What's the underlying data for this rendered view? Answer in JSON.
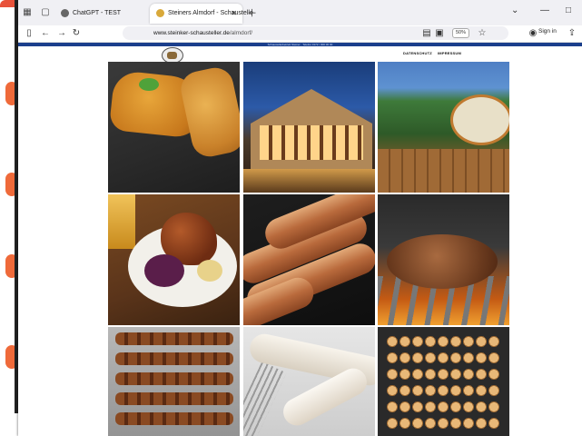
{
  "browser": {
    "tabs": [
      {
        "label": "ChatGPT - TEST",
        "active": false
      },
      {
        "label": "Steiners Almdorf - Schaustelle",
        "active": true
      }
    ],
    "url_scheme_host": "www.steinker-schausteller.de",
    "url_path": "/almdorf/",
    "zoom": "50%",
    "sign_in_label": "Sign in"
  },
  "page": {
    "top_strip_text": "Schaustellerbetrieb Steiner · Telefon 0172 / 000 00 00",
    "menu": [
      "DATENSCHUTZ",
      "IMPRESSUM"
    ]
  },
  "gallery": [
    {
      "subject": "schnitzel"
    },
    {
      "subject": "almhuette-night"
    },
    {
      "subject": "alm-dorf-beer-garden"
    },
    {
      "subject": "schweinshaxe"
    },
    {
      "subject": "bratwurst"
    },
    {
      "subject": "grilled-patty"
    },
    {
      "subject": "skewers"
    },
    {
      "subject": "weisswurst"
    },
    {
      "subject": "kartoffel-racks"
    }
  ]
}
